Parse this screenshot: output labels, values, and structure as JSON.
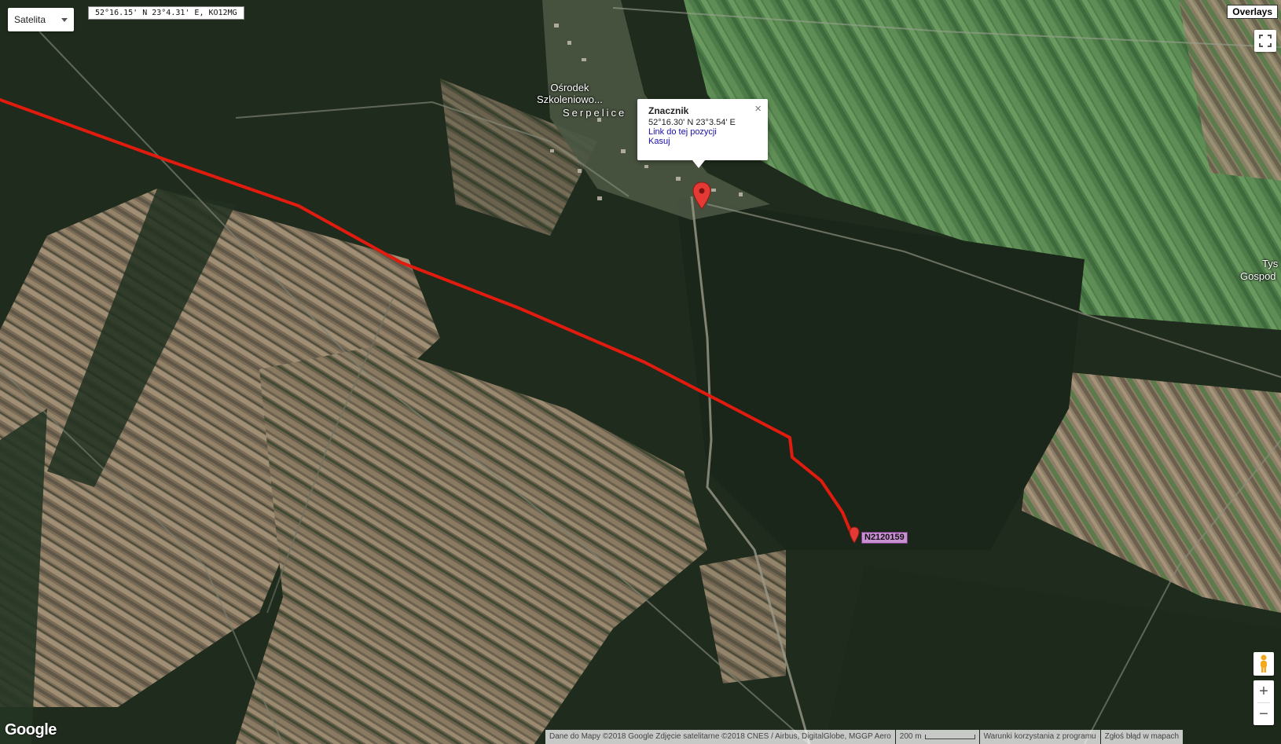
{
  "map_type": {
    "label": "Satelita"
  },
  "coordinates_box": {
    "text": "52°16.15' N 23°4.31' E, KO12MG"
  },
  "overlays_button": {
    "label": "Overlays"
  },
  "places": {
    "osrodek": {
      "line1": "Ośrodek",
      "line2": "Szkoleniowo..."
    },
    "serpelice": "Serpelice",
    "tys": "Tys",
    "gospod": "Gospod"
  },
  "popup": {
    "title": "Znacznik",
    "coords": "52°16.30' N 23°3.54' E",
    "link_label": "Link do tej pozycji",
    "delete_label": "Kasuj",
    "close_glyph": "×"
  },
  "waypoint": {
    "label": "N2120159"
  },
  "route": {
    "color": "#e11b0e"
  },
  "marker": {
    "color": "#e53935"
  },
  "zoom": {
    "in": "+",
    "out": "−"
  },
  "logo": "Google",
  "footer": {
    "attribution": "Dane do Mapy ©2018 Google Zdjęcie satelitarne ©2018 CNES / Airbus, DigitalGlobe, MGGP Aero",
    "scale_label": "200 m",
    "terms": "Warunki korzystania z programu",
    "report": "Zgłoś błąd w mapach"
  },
  "icons": [
    "fullscreen-icon",
    "pegman-icon",
    "marker-pin-icon",
    "waypoint-pin-icon"
  ]
}
